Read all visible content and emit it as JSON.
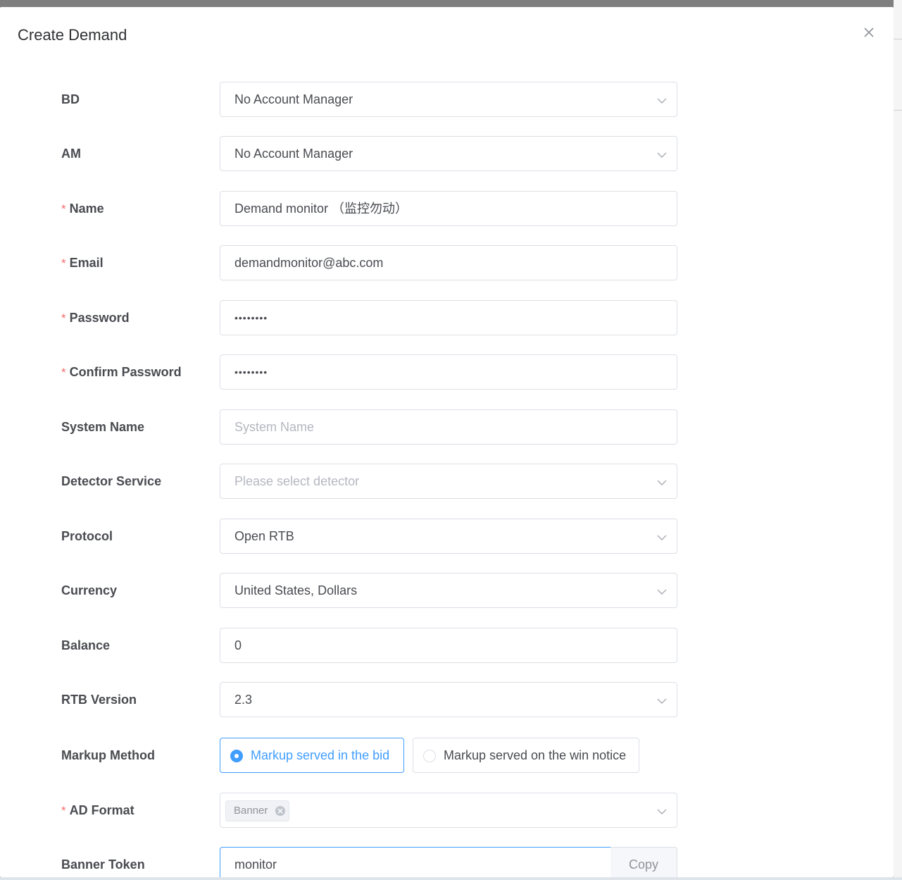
{
  "dialog": {
    "title": "Create Demand"
  },
  "form": {
    "bd": {
      "label": "BD",
      "value": "No Account Manager"
    },
    "am": {
      "label": "AM",
      "value": "No Account Manager"
    },
    "name": {
      "label": "Name",
      "required_mark": "*",
      "value": "Demand monitor （监控勿动）"
    },
    "email": {
      "label": "Email",
      "required_mark": "*",
      "value": "demandmonitor@abc.com"
    },
    "password": {
      "label": "Password",
      "required_mark": "*",
      "value": "••••••••"
    },
    "confirm_password": {
      "label": "Confirm Password",
      "required_mark": "*",
      "value": "••••••••"
    },
    "system_name": {
      "label": "System Name",
      "placeholder": "System Name"
    },
    "detector_service": {
      "label": "Detector Service",
      "placeholder": "Please select detector"
    },
    "protocol": {
      "label": "Protocol",
      "value": "Open RTB"
    },
    "currency": {
      "label": "Currency",
      "value": "United States, Dollars"
    },
    "balance": {
      "label": "Balance",
      "value": "0"
    },
    "rtb_version": {
      "label": "RTB Version",
      "value": "2.3"
    },
    "markup_method": {
      "label": "Markup Method",
      "options": [
        "Markup served in the bid",
        "Markup served on the win notice"
      ],
      "selected": "Markup served in the bid"
    },
    "ad_format": {
      "label": "AD Format",
      "required_mark": "*",
      "tags": [
        "Banner"
      ]
    },
    "banner_token": {
      "label": "Banner Token",
      "value": "monitor",
      "copy_label": "Copy"
    }
  },
  "colors": {
    "primary": "#409eff",
    "required": "#f56c6c",
    "label": "#494b50",
    "placeholder": "#b4b7bf"
  }
}
